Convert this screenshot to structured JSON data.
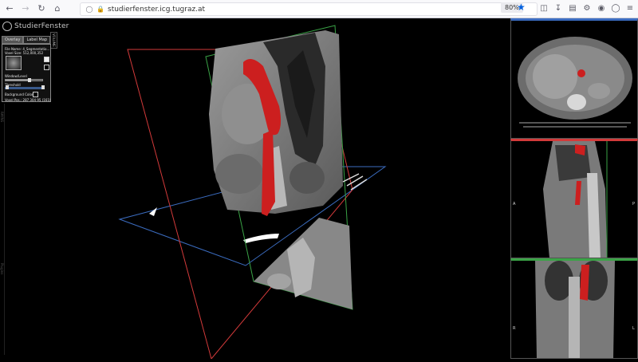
{
  "browser": {
    "url": "studierfenster.icg.tugraz.at",
    "zoom": "80%",
    "icons": [
      "back-arrow-icon",
      "forward-arrow-icon",
      "reload-icon",
      "home-icon",
      "shield-icon",
      "lock-icon",
      "star-icon",
      "pocket-icon",
      "download-icon",
      "reader-icon",
      "extensions-icon",
      "account-icon",
      "menu-icon"
    ]
  },
  "app": {
    "logo_text": "StudierFenster",
    "tabs": [
      "Overlay",
      "Label Map"
    ],
    "volume_tag": "VOLUME",
    "panel": {
      "file_name": "File Name: 4_Segmentatio...",
      "voxel_size": "Voxel Size: 512,000,352",
      "window_level": "Window/Level",
      "threshold": "Threshold",
      "background_color": "Background Color",
      "voxel_pos": "Voxel Pos.: 287 304 95 (161)"
    },
    "sliders": {
      "window_level": 0.6,
      "threshold": 0.95
    },
    "side_labels": [
      "RAYNS",
      "Plugins"
    ]
  },
  "views": {
    "sagittal": {
      "left": "A",
      "right": "P"
    },
    "coronal": {
      "left": "R",
      "right": "L"
    }
  },
  "colors": {
    "axial_frame": "#3b6cc0",
    "sagittal_frame": "#d33a3a",
    "coronal_frame": "#3aa346",
    "segmentation": "#cc1f1f"
  }
}
